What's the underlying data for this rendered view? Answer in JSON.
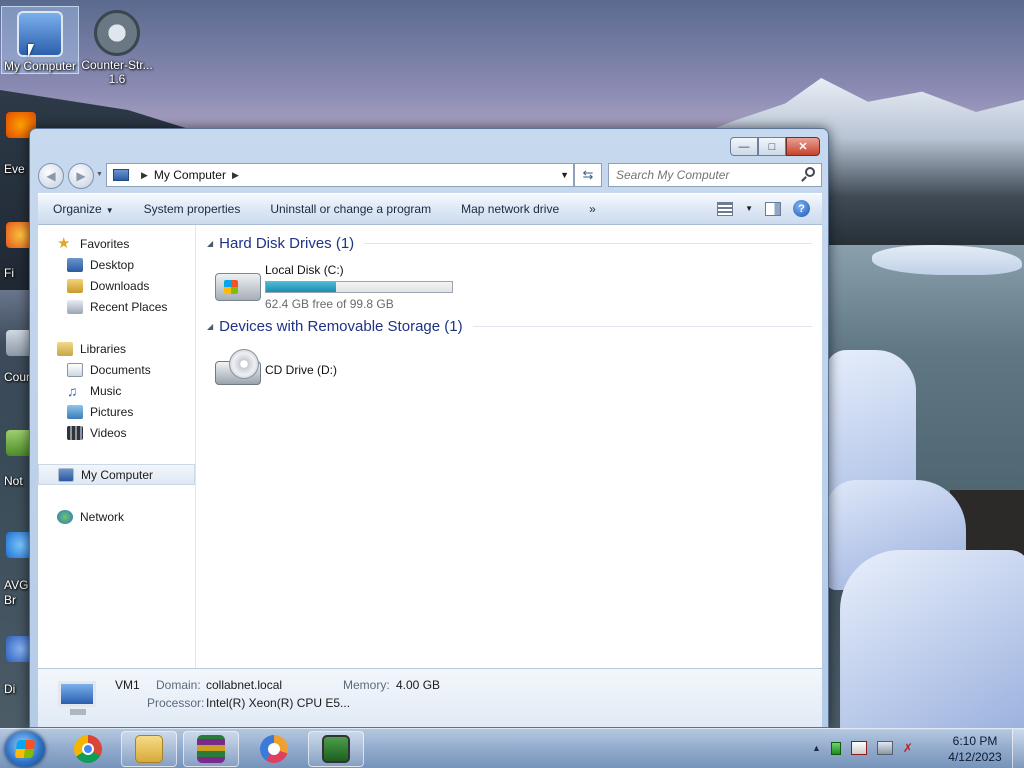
{
  "desktop": {
    "icons": [
      {
        "label": "My Computer",
        "line2": ""
      },
      {
        "label": "Counter-Str...",
        "line2": "1.6"
      }
    ],
    "side_labels": [
      "Eve",
      "Fi",
      "Cour",
      "Not",
      "AVG",
      "Br",
      "Di"
    ]
  },
  "window": {
    "address": {
      "crumb": "My Computer",
      "placeholder": "Search My Computer"
    },
    "toolbar": {
      "organize": "Organize",
      "system_properties": "System properties",
      "uninstall": "Uninstall or change a program",
      "map_drive": "Map network drive",
      "more": "»"
    },
    "nav": {
      "favorites": "Favorites",
      "desktop": "Desktop",
      "downloads": "Downloads",
      "recent": "Recent Places",
      "libraries": "Libraries",
      "documents": "Documents",
      "music": "Music",
      "pictures": "Pictures",
      "videos": "Videos",
      "computer": "My Computer",
      "network": "Network"
    },
    "groups": {
      "hdd_title": "Hard Disk Drives (1)",
      "removable_title": "Devices with Removable Storage (1)"
    },
    "drives": {
      "c_name": "Local Disk (C:)",
      "c_free": "62.4 GB free of 99.8 GB",
      "c_used_fraction": 0.375,
      "d_name": "CD Drive (D:)"
    },
    "details": {
      "name": "VM1",
      "domain_label": "Domain:",
      "domain_value": "collabnet.local",
      "memory_label": "Memory:",
      "memory_value": "4.00 GB",
      "processor_label": "Processor:",
      "processor_value": "Intel(R) Xeon(R) CPU E5..."
    }
  },
  "taskbar": {
    "time": "6:10 PM",
    "date": "4/12/2023",
    "apps": [
      "chrome-icon",
      "explorer-icon",
      "winrar-icon",
      "browser-icon",
      "cpu-icon"
    ]
  },
  "colors": {
    "group_title": "#1e3287",
    "bar_fill": "#1d8db0",
    "accent_close": "#c5432c"
  }
}
